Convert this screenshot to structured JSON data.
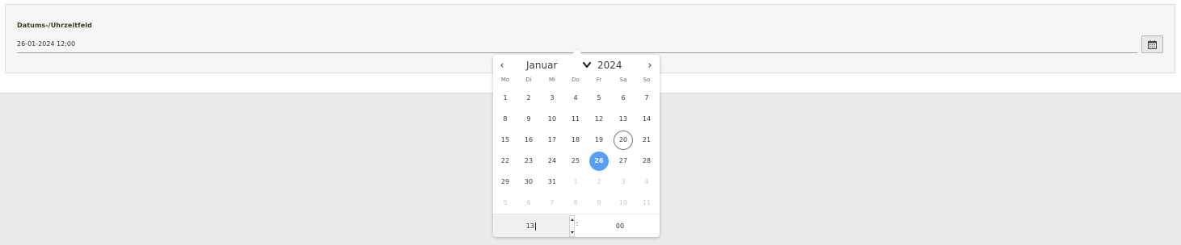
{
  "field": {
    "label": "Datums-/Uhrzeitfeld",
    "value": "26-01-2024 12:00",
    "calendar_button_icon": "calendar-icon"
  },
  "calendar": {
    "prev_icon": "‹",
    "next_icon": "›",
    "month": "Januar",
    "year": "2024",
    "weekdays": [
      "Mo",
      "Di",
      "Mi",
      "Do",
      "Fr",
      "Sa",
      "So"
    ],
    "weeks": [
      [
        {
          "d": "1"
        },
        {
          "d": "2"
        },
        {
          "d": "3"
        },
        {
          "d": "4"
        },
        {
          "d": "5"
        },
        {
          "d": "6"
        },
        {
          "d": "7"
        }
      ],
      [
        {
          "d": "8"
        },
        {
          "d": "9"
        },
        {
          "d": "10"
        },
        {
          "d": "11"
        },
        {
          "d": "12"
        },
        {
          "d": "13"
        },
        {
          "d": "14"
        }
      ],
      [
        {
          "d": "15"
        },
        {
          "d": "16"
        },
        {
          "d": "17"
        },
        {
          "d": "18"
        },
        {
          "d": "19"
        },
        {
          "d": "20",
          "state": "today"
        },
        {
          "d": "21"
        }
      ],
      [
        {
          "d": "22"
        },
        {
          "d": "23"
        },
        {
          "d": "24"
        },
        {
          "d": "25"
        },
        {
          "d": "26",
          "state": "selected"
        },
        {
          "d": "27"
        },
        {
          "d": "28"
        }
      ],
      [
        {
          "d": "29"
        },
        {
          "d": "30"
        },
        {
          "d": "31"
        },
        {
          "d": "1",
          "state": "other"
        },
        {
          "d": "2",
          "state": "other"
        },
        {
          "d": "3",
          "state": "other"
        },
        {
          "d": "4",
          "state": "other"
        }
      ],
      [
        {
          "d": "5",
          "state": "other"
        },
        {
          "d": "6",
          "state": "other"
        },
        {
          "d": "7",
          "state": "other"
        },
        {
          "d": "8",
          "state": "other"
        },
        {
          "d": "9",
          "state": "other"
        },
        {
          "d": "10",
          "state": "other"
        },
        {
          "d": "11",
          "state": "other"
        }
      ]
    ],
    "time": {
      "hour": "13",
      "separator": ":",
      "minute": "00"
    }
  },
  "colors": {
    "selected": "#569ff7",
    "label": "#2e3b1f"
  }
}
